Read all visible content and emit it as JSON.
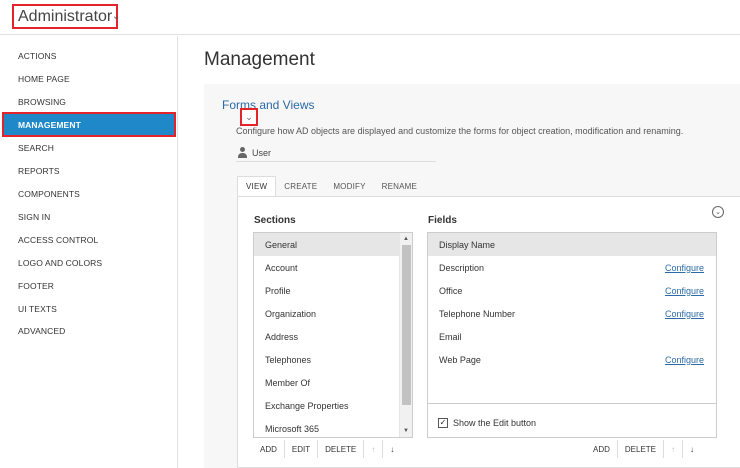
{
  "header": {
    "role": "Administrator",
    "chevron_icon": "chevron-down-icon"
  },
  "sidebar": {
    "items": [
      {
        "label": "ACTIONS",
        "active": false
      },
      {
        "label": "HOME PAGE",
        "active": false
      },
      {
        "label": "BROWSING",
        "active": false
      },
      {
        "label": "MANAGEMENT",
        "active": true
      },
      {
        "label": "SEARCH",
        "active": false
      },
      {
        "label": "REPORTS",
        "active": false
      },
      {
        "label": "COMPONENTS",
        "active": false
      },
      {
        "label": "SIGN IN",
        "active": false
      },
      {
        "label": "ACCESS CONTROL",
        "active": false
      },
      {
        "label": "LOGO AND COLORS",
        "active": false
      },
      {
        "label": "FOOTER",
        "active": false
      },
      {
        "label": "UI TEXTS",
        "active": false
      },
      {
        "label": "ADVANCED",
        "active": false
      }
    ]
  },
  "main": {
    "title": "Management",
    "panel": {
      "title": "Forms and Views",
      "description": "Configure how AD objects are displayed and customize the forms for object creation, modification and renaming.",
      "object_type": "User",
      "tabs": [
        {
          "label": "VIEW",
          "active": true
        },
        {
          "label": "CREATE",
          "active": false
        },
        {
          "label": "MODIFY",
          "active": false
        },
        {
          "label": "RENAME",
          "active": false
        }
      ],
      "sections_header": "Sections",
      "fields_header": "Fields",
      "sections": [
        "General",
        "Account",
        "Profile",
        "Organization",
        "Address",
        "Telephones",
        "Member Of",
        "Exchange Properties",
        "Microsoft 365"
      ],
      "selected_section": "General",
      "fields": [
        {
          "label": "Display Name",
          "link": "",
          "selected": true
        },
        {
          "label": "Description",
          "link": "Configure",
          "selected": false
        },
        {
          "label": "Office",
          "link": "Configure",
          "selected": false
        },
        {
          "label": "Telephone Number",
          "link": "Configure",
          "selected": false
        },
        {
          "label": "Email",
          "link": "",
          "selected": false
        },
        {
          "label": "Web Page",
          "link": "Configure",
          "selected": false
        }
      ],
      "show_edit_button": {
        "label": "Show the Edit button",
        "checked": true
      },
      "section_actions": [
        "ADD",
        "EDIT",
        "DELETE",
        "↑",
        "↓"
      ],
      "field_actions": [
        "ADD",
        "DELETE",
        "↑",
        "↓"
      ]
    }
  },
  "colors": {
    "accent": "#1e88c8",
    "highlight_border": "#e3242b",
    "link": "#2b6aa6"
  }
}
